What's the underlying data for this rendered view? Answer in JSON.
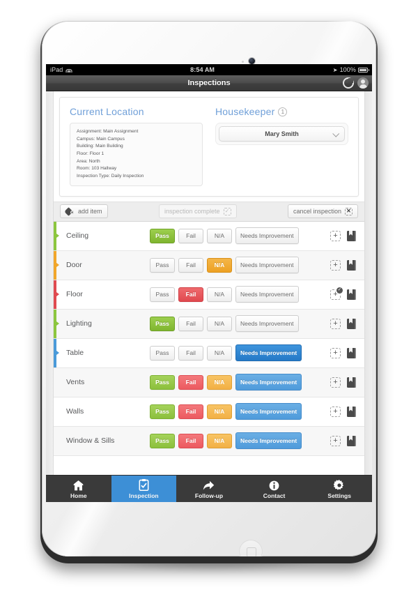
{
  "status_bar": {
    "carrier": "iPad",
    "wifi_icon": "wifi-icon",
    "time": "8:54 AM",
    "location_icon": "location-arrow-icon",
    "battery_percent": "100%",
    "battery_icon": "battery-icon"
  },
  "title_bar": {
    "title": "Inspections",
    "refresh_icon": "refresh-icon",
    "account_icon": "person-icon"
  },
  "header": {
    "location": {
      "heading": "Current Location",
      "details": [
        "Assignment: Main Assignment",
        "Campus: Main Campus",
        "Building: Main Building",
        "Floor: Floor 1",
        "Area: North",
        "Room: 103 Hallway",
        "Inspection Type: Daily Inspection"
      ]
    },
    "housekeeper": {
      "heading": "Housekeeper",
      "badge": "1",
      "selected": "Mary Smith",
      "chevron_icon": "chevron-down-icon"
    }
  },
  "toolbar": {
    "add_item": {
      "label": "add item",
      "icon": "tag-icon",
      "enabled": true
    },
    "inspection_complete": {
      "label": "inspection complete",
      "icon": "check-icon",
      "enabled": false
    },
    "cancel_inspection": {
      "label": "cancel inspection",
      "icon": "x-icon",
      "enabled": true
    }
  },
  "columns": [
    "Pass",
    "Fail",
    "N/A",
    "Needs Improvement"
  ],
  "rows": [
    {
      "label": "Ceiling",
      "bar_color": "#8cc63e",
      "selected": "Pass",
      "tinted": false,
      "has_photo_badge": false
    },
    {
      "label": "Door",
      "bar_color": "#f1a62a",
      "selected": "N/A",
      "tinted": false,
      "has_photo_badge": false
    },
    {
      "label": "Floor",
      "bar_color": "#e04a50",
      "selected": "Fail",
      "tinted": false,
      "has_photo_badge": true
    },
    {
      "label": "Lighting",
      "bar_color": "#8cc63e",
      "selected": "Pass",
      "tinted": false,
      "has_photo_badge": false
    },
    {
      "label": "Table",
      "bar_color": "#4a9ad9",
      "selected": "Needs Improvement",
      "tinted": false,
      "has_photo_badge": false
    },
    {
      "label": "Vents",
      "bar_color": "",
      "selected": "",
      "tinted": true,
      "has_photo_badge": false
    },
    {
      "label": "Walls",
      "bar_color": "",
      "selected": "",
      "tinted": true,
      "has_photo_badge": false
    },
    {
      "label": "Window & Sills",
      "bar_color": "",
      "selected": "",
      "tinted": true,
      "has_photo_badge": false
    }
  ],
  "row_actions": {
    "add_photo_icon": "plus-icon",
    "add_photo_badge": "✓",
    "notes_icon": "book-icon"
  },
  "tabs": [
    {
      "label": "Home",
      "icon": "home-icon",
      "active": false
    },
    {
      "label": "Inspection",
      "icon": "clipboard-icon",
      "active": true
    },
    {
      "label": "Follow-up",
      "icon": "arrow-icon",
      "active": false
    },
    {
      "label": "Contact",
      "icon": "info-icon",
      "active": false
    },
    {
      "label": "Settings",
      "icon": "gear-icon",
      "active": false
    }
  ],
  "colors": {
    "pass": "#8cc63e",
    "fail": "#e04a50",
    "na": "#f1a62a",
    "needs_improvement": "#2e86d4",
    "accent": "#3d8fd6",
    "heading": "#6f9fd8"
  }
}
